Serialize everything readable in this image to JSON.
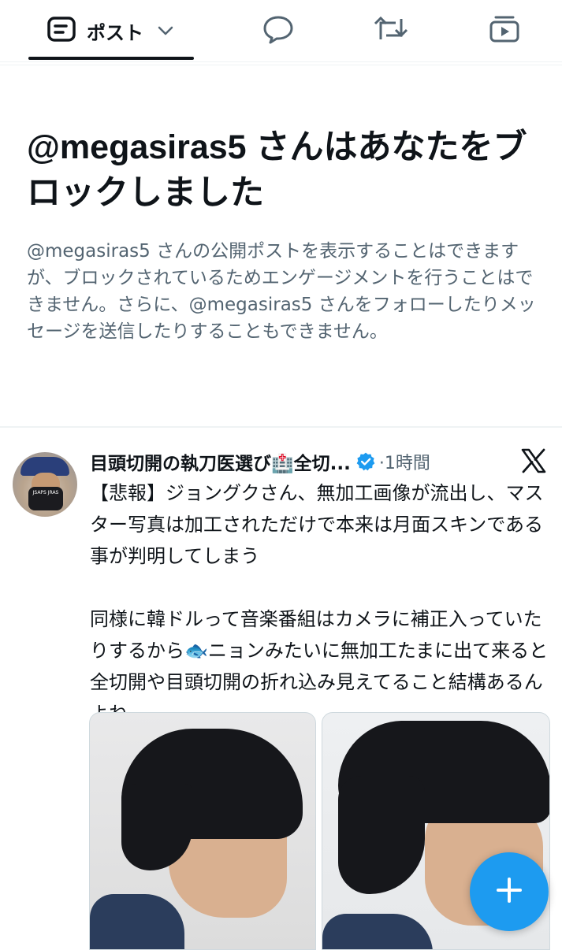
{
  "tabs": {
    "posts_label": "ポスト"
  },
  "notice": {
    "title": "@megasiras5 さんはあなたをブロックしました",
    "description": "@megasiras5 さんの公開ポストを表示することはできますが、ブロックされているためエンゲージメントを行うことはできません。さらに、@megasiras5 さんをフォローしたりメッセージを送信したりすることもできません。"
  },
  "tweet": {
    "author": "目頭切開の執刀医選び🏥全切...",
    "time": "·1時間",
    "avatar_text": "JSAPS JRAS",
    "text": "【悲報】ジョングクさん、無加工画像が流出し、マスター写真は加工されただけで本来は月面スキンである事が判明してしまう\n\n同様に韓ドルって音楽番組はカメラに補正入っていたりするから🐟ニョンみたいに無加工たまに出て来ると全切開や目頭切開の折れ込み見えてること結構あるんよね。"
  },
  "colors": {
    "accent": "#1d9bf0",
    "text_primary": "#0f1419",
    "text_secondary": "#536471"
  },
  "icons": [
    "posts-icon",
    "chevron-down-icon",
    "reply-icon",
    "repost-icon",
    "media-icon",
    "verified-badge-icon",
    "x-logo-icon",
    "plus-icon"
  ]
}
